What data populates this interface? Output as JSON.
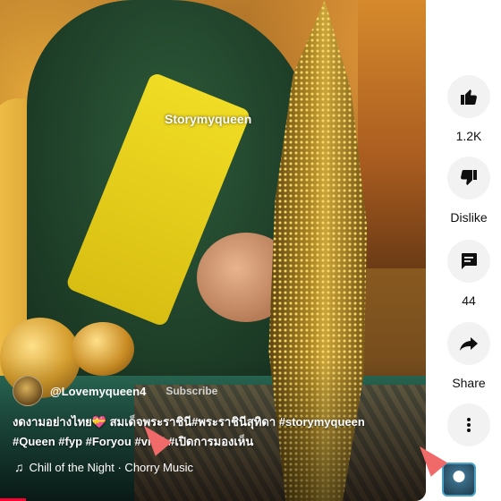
{
  "video": {
    "watermark": "Storymyqueen"
  },
  "overlay": {
    "channel_name": "@Lovemyqueen4",
    "subscribe_label": "Subscribe",
    "caption_line1": "งดงามอย่างไทย💝 สมเด็จพระราชินี#พระราชินีสุทิดา #storymyqueen",
    "caption_line2": "#Queen #fyp #Foryou #viral #เปิดการมองเห็น",
    "music_text": "Chill of the Night · Chorry Music",
    "progress_fraction": 0.06
  },
  "actions": {
    "like_count": "1.2K",
    "dislike_label": "Dislike",
    "comment_count": "44",
    "share_label": "Share"
  },
  "colors": {
    "accent": "#ff0033",
    "button_bg": "#f2f2f2",
    "cursor_highlight": "#f06a6a"
  },
  "icons": [
    "thumbs-up-icon",
    "thumbs-down-icon",
    "comment-icon",
    "share-icon",
    "more-icon",
    "music-note-icon"
  ]
}
